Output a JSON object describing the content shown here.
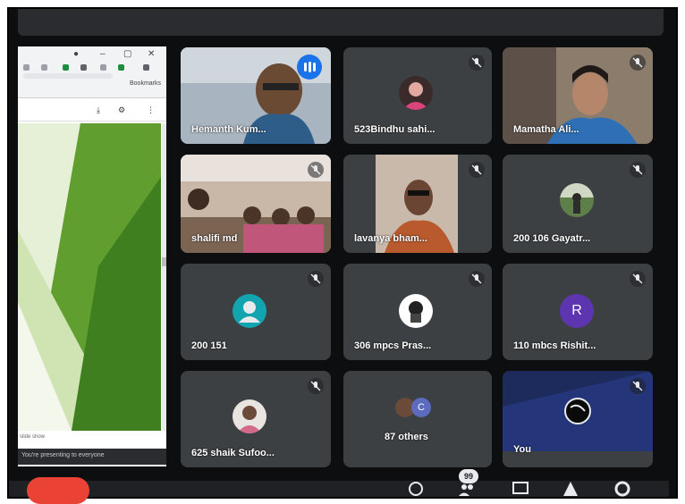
{
  "presentation": {
    "bookmarks_label": "Bookmarks",
    "slide_status": "slide show",
    "banner": "You're presenting to everyone"
  },
  "participants": [
    {
      "name": "Hemanth Kum...",
      "speaking": true
    },
    {
      "name": "523Bindhu sahi...",
      "muted": true
    },
    {
      "name": "Mamatha Ali...",
      "muted": true
    },
    {
      "name": "shalifi md",
      "muted": true
    },
    {
      "name": "lavanya bham...",
      "muted": true
    },
    {
      "name": "200 106 Gayatr...",
      "muted": true
    },
    {
      "name": "200 151",
      "muted": true
    },
    {
      "name": "306 mpcs Pras...",
      "muted": true
    },
    {
      "name": "110 mbcs Rishit...",
      "muted": true,
      "initial": "R"
    },
    {
      "name": "625 shaik Sufoo...",
      "muted": true
    },
    {
      "name": "87 others",
      "bubble_initial": "C"
    },
    {
      "name": "You",
      "muted": true
    }
  ],
  "toolbar": {
    "participants_count": "99"
  },
  "colors": {
    "tile_bg": "#3c4043",
    "speaking_outline": "#8ab4f8",
    "leave_red": "#ea4335",
    "avatar_teal": "#12a4af",
    "avatar_purple": "#5e35b1"
  }
}
